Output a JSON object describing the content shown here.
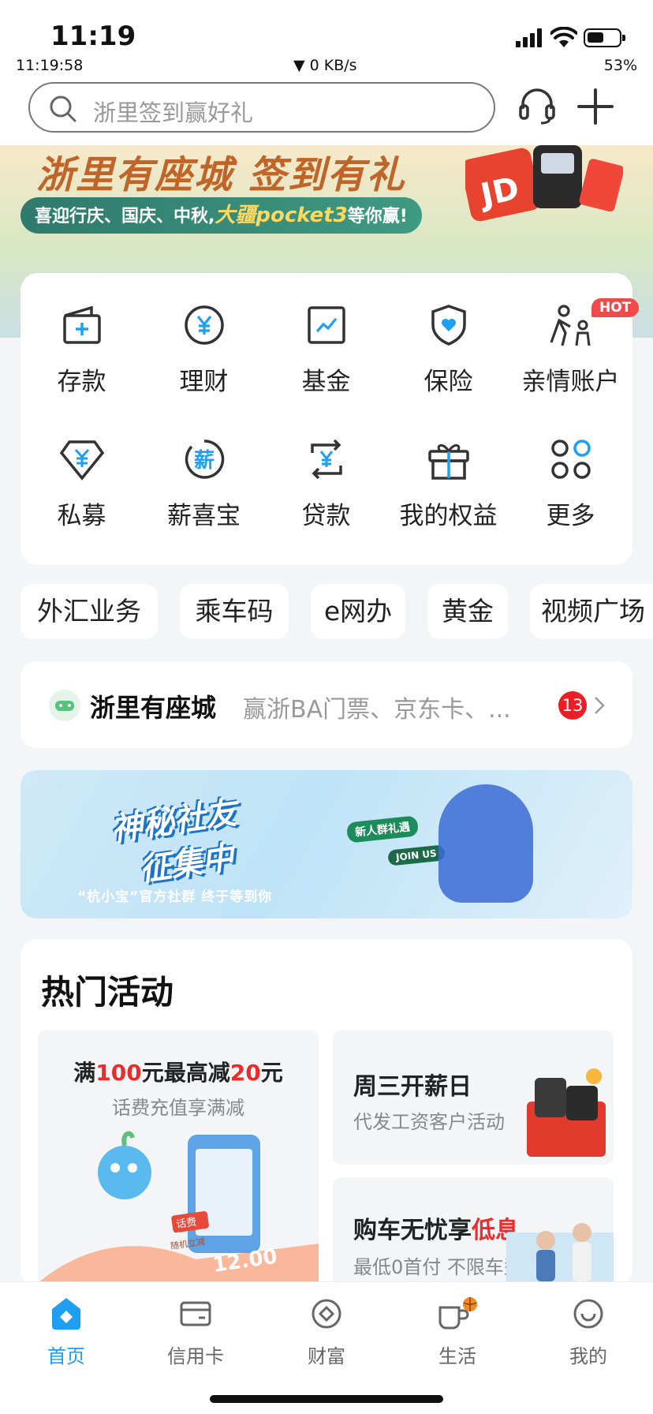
{
  "status": {
    "time": "11:19",
    "seconds": "11:19:58",
    "network": "▼ 0 KB/s",
    "battery": "53%"
  },
  "search": {
    "placeholder": "浙里签到赢好礼"
  },
  "banner": {
    "title": "浙里有座城 签到有礼",
    "subtitle_prefix": "喜迎行庆、国庆、中秋,",
    "subtitle_highlight": "大疆pocket3",
    "subtitle_suffix": "等你赢!",
    "gift_label": "JD"
  },
  "grid": {
    "row1": [
      {
        "label": "存款",
        "icon": "deposit-icon"
      },
      {
        "label": "理财",
        "icon": "yen-circle-icon"
      },
      {
        "label": "基金",
        "icon": "chart-icon"
      },
      {
        "label": "保险",
        "icon": "shield-icon"
      },
      {
        "label": "亲情账户",
        "icon": "family-icon",
        "badge": "HOT"
      }
    ],
    "row2": [
      {
        "label": "私募",
        "icon": "diamond-yen-icon"
      },
      {
        "label": "薪喜宝",
        "icon": "salary-icon",
        "glyph": "薪"
      },
      {
        "label": "贷款",
        "icon": "loan-icon"
      },
      {
        "label": "我的权益",
        "icon": "gift-icon"
      },
      {
        "label": "更多",
        "icon": "more-icon"
      }
    ]
  },
  "chips": [
    "外汇业务",
    "乘车码",
    "e网办",
    "黄金",
    "视频广场"
  ],
  "notice": {
    "title": "浙里有座城",
    "desc": "赢浙BA门票、京东卡、...",
    "badge": "13"
  },
  "promo": {
    "line1": "神秘社友",
    "line2": "征集中",
    "footer": "“杭小宝”官方社群  终于等到你",
    "tag1": "新人群礼遇",
    "tag2": "JOIN US"
  },
  "activities": {
    "title": "热门活动",
    "card1": {
      "t_a": "满",
      "t_b": "100",
      "t_c": "元最高减",
      "t_d": "20",
      "t_e": "元",
      "sub": "话费充值享满减",
      "stamp": "话费",
      "stamp_sub": "随机立减",
      "amount": "12.00"
    },
    "card2": {
      "title": "周三开薪日",
      "sub": "代发工资客户活动"
    },
    "card3": {
      "title_a": "购车无忧享",
      "title_b": "低息",
      "sub": "最低0首付 不限车型"
    }
  },
  "tabs": [
    {
      "label": "首页",
      "icon": "home-icon"
    },
    {
      "label": "信用卡",
      "icon": "credit-card-icon"
    },
    {
      "label": "财富",
      "icon": "wealth-icon"
    },
    {
      "label": "生活",
      "icon": "life-cup-icon"
    },
    {
      "label": "我的",
      "icon": "profile-icon"
    }
  ],
  "colors": {
    "accent": "#1e9ff2",
    "highlight": "#ee2b2b",
    "badge": "#ee1c25"
  }
}
